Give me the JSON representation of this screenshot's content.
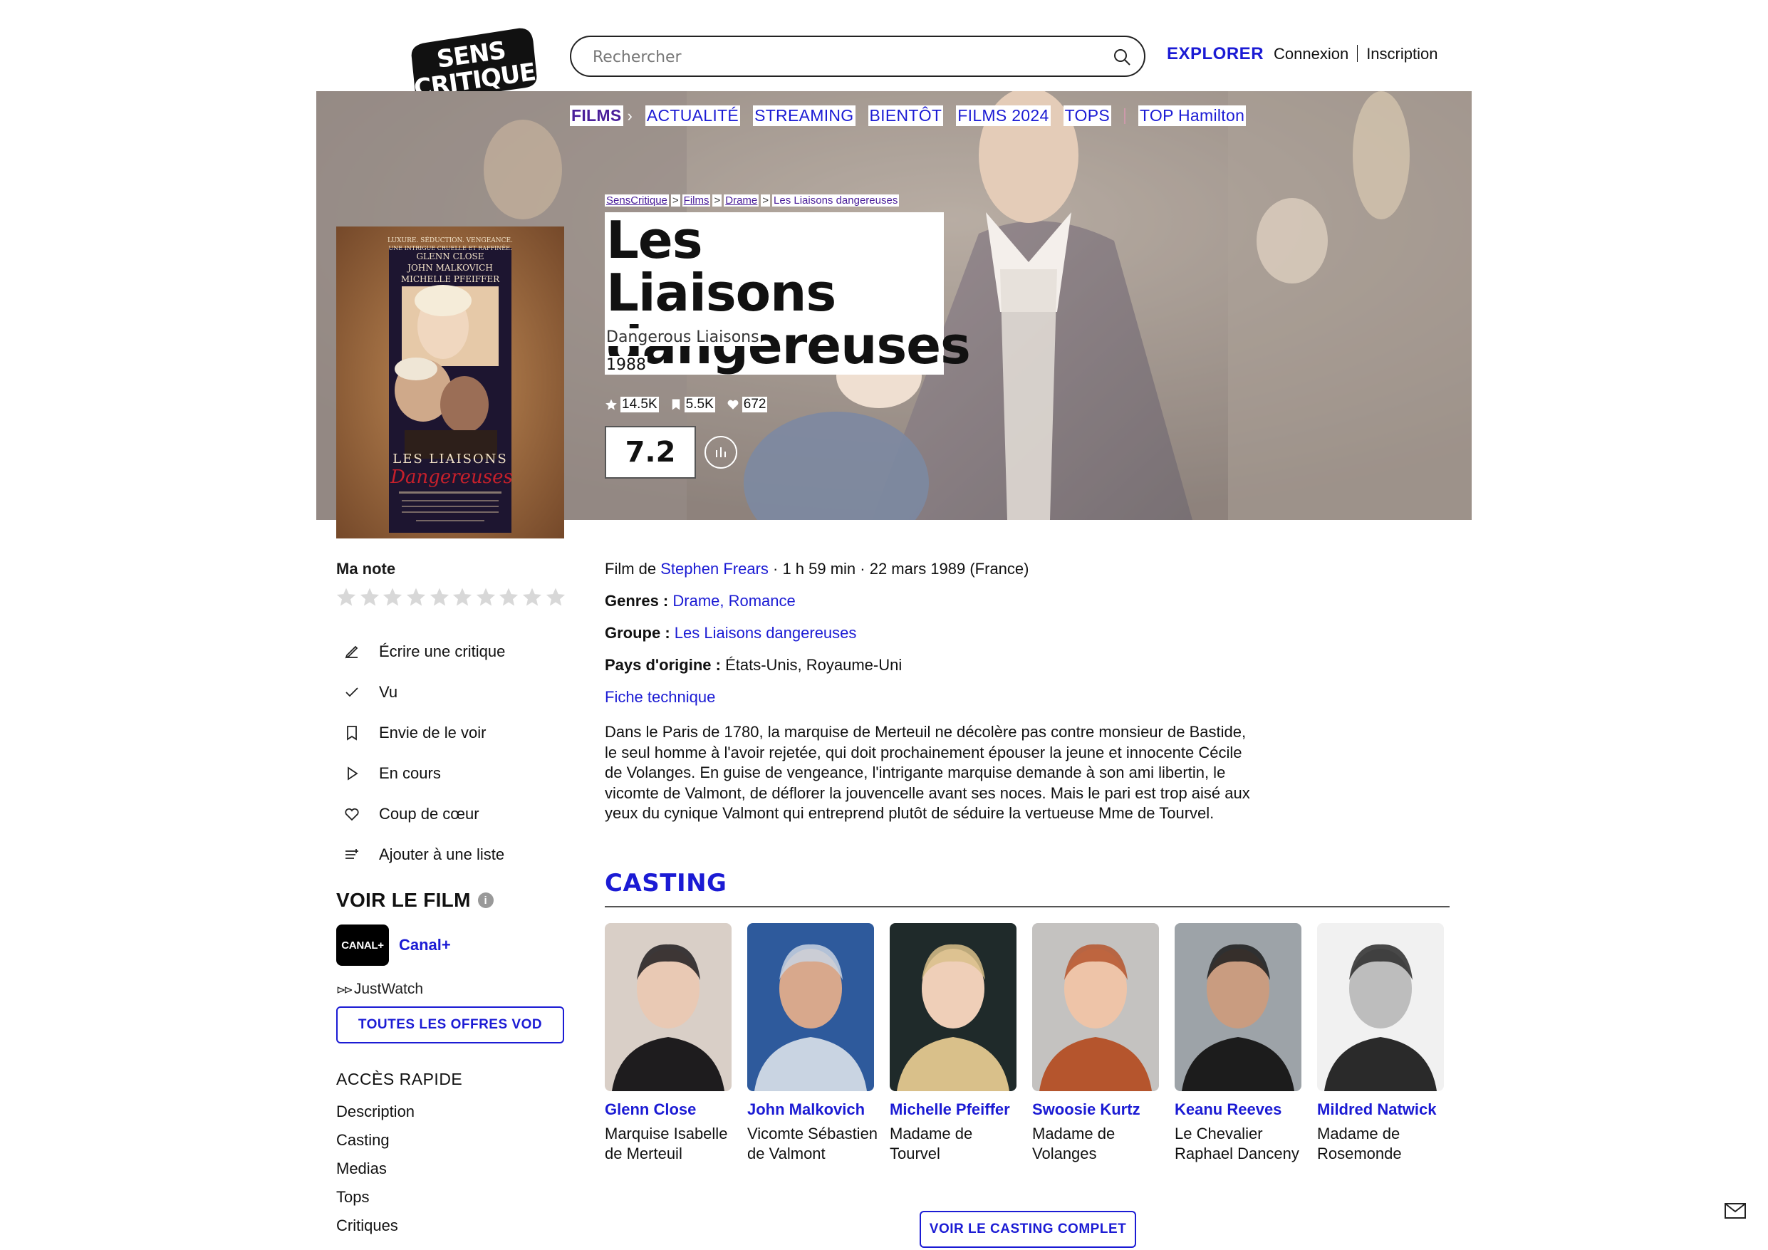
{
  "header": {
    "logo_lines": [
      "SENS",
      "CRITIQUE"
    ],
    "search_placeholder": "Rechercher",
    "explorer": "EXPLORER",
    "login": "Connexion",
    "signup": "Inscription"
  },
  "menu": {
    "active": "FILMS",
    "items": [
      "ACTUALITÉ",
      "STREAMING",
      "BIENTÔT",
      "FILMS 2024",
      "TOPS",
      "TOP Hamilton"
    ]
  },
  "breadcrumb": [
    "SensCritique",
    "Films",
    "Drame",
    "Les Liaisons dangereuses"
  ],
  "film": {
    "title": "Les Liaisons dangereuses",
    "original_title": "Dangerous Liaisons",
    "year": "1988",
    "stats": {
      "ratings": "14.5K",
      "wishes": "5.5K",
      "favorites": "672"
    },
    "score": "7.2",
    "poster": {
      "tagline_1": "LUXURE. SÉDUCTION. VENGEANCE.",
      "tagline_2": "UNE INTRIGUE CRUELLE ET RAFFINÉE.",
      "actors": [
        "GLENN CLOSE",
        "JOHN MALKOVICH",
        "MICHELLE PFEIFFER"
      ],
      "title_line_1": "LES LIAISONS",
      "title_line_2": "Dangereuses"
    }
  },
  "rating": {
    "label": "Ma note",
    "stars_count": 10
  },
  "actions": [
    {
      "icon": "pencil-icon",
      "label": "Écrire une critique"
    },
    {
      "icon": "check-icon",
      "label": "Vu"
    },
    {
      "icon": "bookmark-icon",
      "label": "Envie de le voir"
    },
    {
      "icon": "play-icon",
      "label": "En cours"
    },
    {
      "icon": "heart-icon",
      "label": "Coup de cœur"
    },
    {
      "icon": "list-add-icon",
      "label": "Ajouter à une liste"
    }
  ],
  "watch": {
    "heading": "VOIR LE FILM",
    "provider_logo": "CANAL+",
    "provider_name": "Canal+",
    "justwatch": "JustWatch",
    "vod_button": "TOUTES LES OFFRES VOD"
  },
  "quick_access": {
    "heading": "ACCÈS RAPIDE",
    "items": [
      "Description",
      "Casting",
      "Medias",
      "Tops",
      "Critiques"
    ]
  },
  "details": {
    "film_de_prefix": "Film de ",
    "director": "Stephen Frears",
    "meta": " · 1 h 59 min · 22 mars 1989 (France)",
    "genres_label": "Genres : ",
    "genres": "Drame, Romance",
    "groupe_label": "Groupe : ",
    "groupe": "Les Liaisons dangereuses",
    "pays_label": "Pays d'origine : ",
    "pays": "États-Unis, Royaume-Uni",
    "fiche": "Fiche technique",
    "synopsis": "Dans le Paris de 1780, la marquise de Merteuil ne décolère pas contre monsieur de Bastide, le seul homme à l'avoir rejetée, qui doit prochainement épouser la jeune et innocente Cécile de Volanges. En guise de vengeance, l'intrigante marquise demande à son ami libertin, le vicomte de Valmont, de déflorer la jouvencelle avant ses noces. Mais le pari est trop aisé aux yeux du cynique Valmont qui entreprend plutôt de séduire la vertueuse Mme de Tourvel."
  },
  "casting": {
    "heading": "CASTING",
    "button": "VOIR LE CASTING COMPLET",
    "actors": [
      {
        "name": "Glenn Close",
        "role": "Marquise Isabelle de Merteuil"
      },
      {
        "name": "John Malkovich",
        "role": "Vicomte Sébastien de Valmont"
      },
      {
        "name": "Michelle Pfeiffer",
        "role": "Madame de Tourvel"
      },
      {
        "name": "Swoosie Kurtz",
        "role": "Madame de Volanges"
      },
      {
        "name": "Keanu Reeves",
        "role": "Le Chevalier Raphael Danceny"
      },
      {
        "name": "Mildred Natwick",
        "role": "Madame de Rosemonde"
      }
    ]
  },
  "colors": {
    "accent": "#1b1bd4",
    "menu_active": "#4a1f9a"
  }
}
